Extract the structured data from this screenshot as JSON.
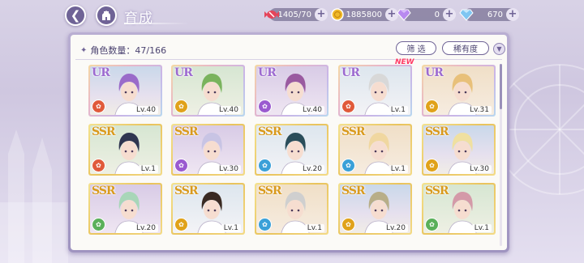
{
  "topbar": {
    "title": "育成",
    "back_icon": "back-arrow-icon",
    "home_icon": "castle-home-icon"
  },
  "resources": [
    {
      "name": "stamina",
      "icon": "candy-icon",
      "value": "1405/70"
    },
    {
      "name": "gold",
      "icon": "coin-icon",
      "value": "1885800"
    },
    {
      "name": "purple-gem",
      "icon": "purple-diamond-icon",
      "value": "0"
    },
    {
      "name": "blue-gem",
      "icon": "blue-diamond-icon",
      "value": "670"
    }
  ],
  "panel": {
    "count_label": "角色数量：47/166",
    "filter_label": "筛 选",
    "rarity_label": "稀有度",
    "sort_icon": "sort-toggle-icon"
  },
  "colors": {
    "panel_border": "#9f94c0",
    "accent": "#6f6396",
    "ur_frame": "#c8b6e8",
    "ssr_frame": "#e9c35c",
    "new_badge": "#ff3a63"
  },
  "cards": [
    {
      "rarity": "UR",
      "level": "Lv.40",
      "attr_color": "#e05a3a",
      "hair": "#9a6bc9",
      "new": false
    },
    {
      "rarity": "UR",
      "level": "Lv.40",
      "attr_color": "#e0a21a",
      "hair": "#7ab35d",
      "new": false
    },
    {
      "rarity": "UR",
      "level": "Lv.40",
      "attr_color": "#9a5ad0",
      "hair": "#9a5aa0",
      "new": false
    },
    {
      "rarity": "UR",
      "level": "Lv.1",
      "attr_color": "#e05a3a",
      "hair": "#d8d8d8",
      "new": true
    },
    {
      "rarity": "UR",
      "level": "Lv.31",
      "attr_color": "#e0a21a",
      "hair": "#e8c07a",
      "new": false
    },
    {
      "rarity": "SSR",
      "level": "Lv.1",
      "attr_color": "#e05a3a",
      "hair": "#2f3550",
      "new": false
    },
    {
      "rarity": "SSR",
      "level": "Lv.30",
      "attr_color": "#9a5ad0",
      "hair": "#c8c4e4",
      "new": false
    },
    {
      "rarity": "SSR",
      "level": "Lv.20",
      "attr_color": "#3aa0d8",
      "hair": "#2a4d5a",
      "new": false
    },
    {
      "rarity": "SSR",
      "level": "Lv.1",
      "attr_color": "#3aa0d8",
      "hair": "#f0d7a0",
      "new": false
    },
    {
      "rarity": "SSR",
      "level": "Lv.30",
      "attr_color": "#e0a21a",
      "hair": "#f0e0a0",
      "new": false
    },
    {
      "rarity": "SSR",
      "level": "Lv.20",
      "attr_color": "#5ab05a",
      "hair": "#a8d6b8",
      "new": false
    },
    {
      "rarity": "SSR",
      "level": "Lv.1",
      "attr_color": "#e0a21a",
      "hair": "#3a2a22",
      "new": false
    },
    {
      "rarity": "SSR",
      "level": "Lv.1",
      "attr_color": "#3aa0d8",
      "hair": "#cfcfcf",
      "new": false
    },
    {
      "rarity": "SSR",
      "level": "Lv.20",
      "attr_color": "#e0a21a",
      "hair": "#b8ae88",
      "new": false
    },
    {
      "rarity": "SSR",
      "level": "Lv.1",
      "attr_color": "#5ab05a",
      "hair": "#d49aa8",
      "new": false
    }
  ]
}
